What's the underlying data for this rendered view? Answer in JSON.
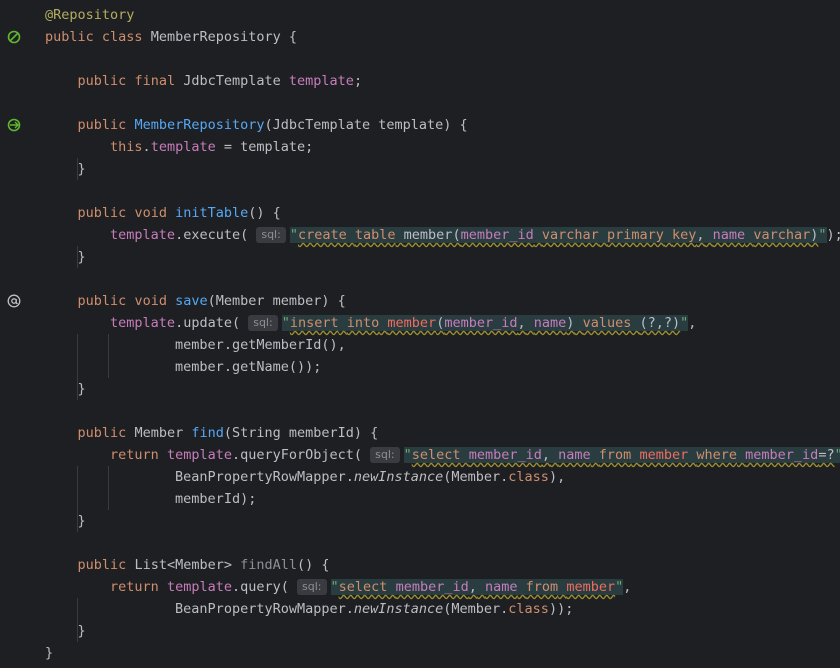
{
  "colors": {
    "background": "#1e1f22",
    "keyword": "#cf8e6d",
    "annotation": "#b3ae60",
    "field": "#c77dbb",
    "method_declaration": "#56a8f5",
    "string": "#6aab73",
    "sql_table": "#ef6c5e",
    "default_text": "#bcbec4",
    "inlay_hint_bg": "#393b40",
    "sql_injection_bg": "#293c40"
  },
  "gutter_icons": [
    "spring-bean-icon",
    "spring-bean-icon",
    "override-annotation-icon"
  ],
  "inlay_hint": "sql:",
  "code": {
    "l1_annotation": "@Repository",
    "l2_public": "public",
    "l2_class": "class",
    "l2_name": "MemberRepository {",
    "l4_public": "public",
    "l4_final": "final",
    "l4_type": "JdbcTemplate",
    "l4_field": "template",
    "l4_semi": ";",
    "l6_public": "public",
    "l6_ctor": "MemberRepository",
    "l6_params": "(JdbcTemplate template) {",
    "l7_this": "this",
    "l7_dot": ".",
    "l7_field": "template",
    "l7_rest": " = template;",
    "l8_close": "}",
    "l10_public": "public",
    "l10_void": "void",
    "l10_method": "initTable",
    "l10_rest": "() {",
    "l11_field": "template",
    "l11_call": ".execute( ",
    "l11_open": "\"",
    "l11_s1": "create",
    "l11_s2": "table",
    "l11_s3": "member",
    "l11_s4": "(",
    "l11_s5": "member_id",
    "l11_s6": "varchar",
    "l11_s7": "primary",
    "l11_s8": "key",
    "l11_s9": ",",
    "l11_s10": "name",
    "l11_s11": "varchar",
    "l11_s12": ")",
    "l11_close": "\"",
    "l11_end": ");",
    "l12_close": "}",
    "l14_public": "public",
    "l14_void": "void",
    "l14_method": "save",
    "l14_rest": "(Member member) {",
    "l15_field": "template",
    "l15_call": ".update( ",
    "l15_open": "\"",
    "l15_s1": "insert",
    "l15_s2": "into",
    "l15_s3": "member",
    "l15_s4": "(",
    "l15_s5": "member_id",
    "l15_s6": ",",
    "l15_s7": "name",
    "l15_s8": ")",
    "l15_s9": "values",
    "l15_s10": "(?,?)",
    "l15_close": "\"",
    "l15_end": ",",
    "l16_text": "member.getMemberId(),",
    "l17_text": "member.getName());",
    "l18_close": "}",
    "l20_public": "public",
    "l20_type": "Member",
    "l20_method": "find",
    "l20_rest": "(String memberId) {",
    "l21_return": "return",
    "l21_field": "template",
    "l21_call": ".queryForObject( ",
    "l21_open": "\"",
    "l21_s1": "select",
    "l21_s2": "member_id",
    "l21_s3": ",",
    "l21_s4": "name",
    "l21_s5": "from",
    "l21_s6": "member",
    "l21_s7": "where",
    "l21_s8": "member_id",
    "l21_s9": "=?",
    "l21_close": "\"",
    "l21_end": ",",
    "l22_a": "BeanPropertyRowMapper.",
    "l22_static": "newInstance",
    "l22_b": "(Member.",
    "l22_class": "class",
    "l22_c": "),",
    "l23_text": "memberId);",
    "l24_close": "}",
    "l26_public": "public",
    "l26_type": "List<Member>",
    "l26_method": "findAll",
    "l26_rest": "() {",
    "l27_return": "return",
    "l27_field": "template",
    "l27_call": ".query( ",
    "l27_open": "\"",
    "l27_s1": "select",
    "l27_s2": "member_id",
    "l27_s3": ",",
    "l27_s4": "name",
    "l27_s5": "from",
    "l27_s6": "member",
    "l27_close": "\"",
    "l27_end": ",",
    "l28_a": "BeanPropertyRowMapper.",
    "l28_static": "newInstance",
    "l28_b": "(Member.",
    "l28_class": "class",
    "l28_c": "));",
    "l29_close": "}",
    "l30_close": "}"
  }
}
